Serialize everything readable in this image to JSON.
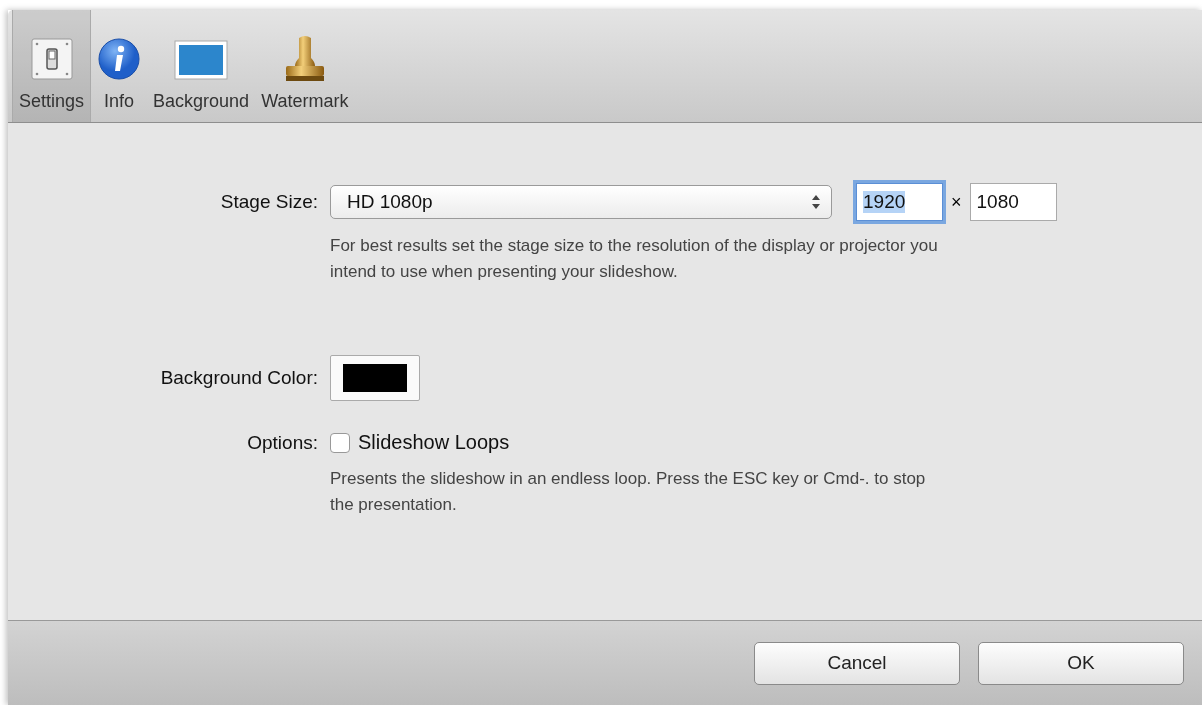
{
  "toolbar": [
    {
      "label": "Settings",
      "kind": "switch",
      "selected": true
    },
    {
      "label": "Info",
      "kind": "info",
      "selected": false
    },
    {
      "label": "Background",
      "kind": "background",
      "selected": false
    },
    {
      "label": "Watermark",
      "kind": "stamp",
      "selected": false
    }
  ],
  "stage_size": {
    "label": "Stage Size:",
    "value": "HD 1080p",
    "width": {
      "value": "1920",
      "focused": true
    },
    "times": "×",
    "height": {
      "value": "1080",
      "focused": false
    },
    "help": "For best results set the stage size to the resolution of the display or projector you intend to use when presenting your slideshow."
  },
  "background_color": {
    "label": "Background Color:",
    "color": "#000000"
  },
  "options": {
    "label": "Options:",
    "checkbox": {
      "label": "Slideshow Loops",
      "checked": false
    },
    "help": "Presents the slideshow in an endless loop. Press the ESC key or Cmd-. to stop the presentation."
  },
  "buttons": [
    {
      "label": "Cancel"
    },
    {
      "label": "OK"
    }
  ]
}
